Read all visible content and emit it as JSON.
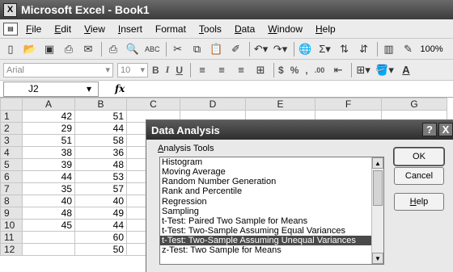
{
  "window": {
    "title": "Microsoft Excel - Book1",
    "app_icon": "excel-icon"
  },
  "menu": {
    "doc_icon": "workbook-icon",
    "items": [
      {
        "key": "F",
        "rest": "ile"
      },
      {
        "key": "E",
        "rest": "dit"
      },
      {
        "key": "V",
        "rest": "iew"
      },
      {
        "key": "I",
        "rest": "nsert"
      },
      {
        "key": "",
        "rest": "Format"
      },
      {
        "key": "T",
        "rest": "ools"
      },
      {
        "key": "D",
        "rest": "ata"
      },
      {
        "key": "W",
        "rest": "indow"
      },
      {
        "key": "H",
        "rest": "elp"
      }
    ]
  },
  "toolbar": {
    "zoom": "100%"
  },
  "format_toolbar": {
    "font": "Arial",
    "size": "10",
    "bold": "B",
    "italic": "I",
    "underline": "U",
    "currency": "$",
    "percent": "%",
    "comma": ",",
    "decimals": ".00"
  },
  "formula_bar": {
    "name_box": "J2",
    "fx": "fx"
  },
  "sheet": {
    "columns": [
      "A",
      "B",
      "C",
      "D",
      "E",
      "F",
      "G"
    ],
    "rows": [
      {
        "n": "1",
        "a": "42",
        "b": "51"
      },
      {
        "n": "2",
        "a": "29",
        "b": "44"
      },
      {
        "n": "3",
        "a": "51",
        "b": "58"
      },
      {
        "n": "4",
        "a": "38",
        "b": "36"
      },
      {
        "n": "5",
        "a": "39",
        "b": "48"
      },
      {
        "n": "6",
        "a": "44",
        "b": "53"
      },
      {
        "n": "7",
        "a": "35",
        "b": "57"
      },
      {
        "n": "8",
        "a": "40",
        "b": "40"
      },
      {
        "n": "9",
        "a": "48",
        "b": "49"
      },
      {
        "n": "10",
        "a": "45",
        "b": "44"
      },
      {
        "n": "11",
        "a": "",
        "b": "60"
      },
      {
        "n": "12",
        "a": "",
        "b": "50"
      }
    ]
  },
  "dialog": {
    "title": "Data Analysis",
    "help_glyph": "?",
    "close_glyph": "X",
    "label_key": "A",
    "label_rest": "nalysis Tools",
    "tools": [
      "Histogram",
      "Moving Average",
      "Random Number Generation",
      "Rank and Percentile",
      "Regression",
      "Sampling",
      "t-Test: Paired Two Sample for Means",
      "t-Test: Two-Sample Assuming Equal Variances",
      "t-Test: Two-Sample Assuming Unequal Variances",
      "z-Test: Two Sample for Means"
    ],
    "selected_tool": "t-Test: Two-Sample Assuming Unequal Variances",
    "ok": "OK",
    "cancel": "Cancel",
    "help_key": "H",
    "help_rest": "elp"
  }
}
